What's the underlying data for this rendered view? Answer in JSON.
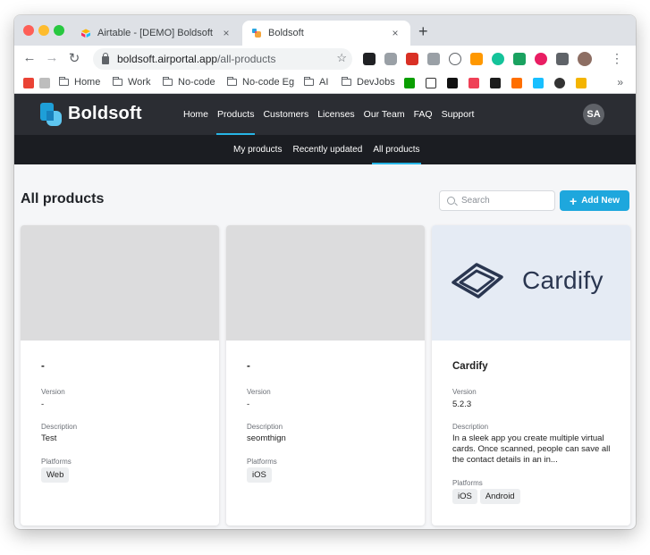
{
  "browser": {
    "tabs": [
      {
        "title": "Airtable - [DEMO] Boldsoft",
        "active": false
      },
      {
        "title": "Boldsoft",
        "active": true
      }
    ],
    "tab_close_glyph": "×",
    "new_tab_glyph": "+",
    "nav": {
      "back_glyph": "←",
      "forward_glyph": "→",
      "reload_glyph": "↻"
    },
    "url": {
      "host": "boldsoft.airportal.app",
      "path": "/all-products"
    },
    "star_glyph": "☆",
    "menu_glyph": "⋮",
    "bookmarks": [
      {
        "label": "Home",
        "icon": "folder-icon"
      },
      {
        "label": "Work",
        "icon": "folder-icon"
      },
      {
        "label": "No-code",
        "icon": "folder-icon"
      },
      {
        "label": "No-code Eg",
        "icon": "folder-icon"
      },
      {
        "label": "AI",
        "icon": "folder-icon"
      },
      {
        "label": "DevJobs",
        "icon": "folder-icon"
      }
    ],
    "bookmark_more_glyph": "»"
  },
  "app": {
    "brand": "Boldsoft",
    "nav": [
      "Home",
      "Products",
      "Customers",
      "Licenses",
      "Our Team",
      "FAQ",
      "Support"
    ],
    "nav_active": "Products",
    "user_initials": "SA",
    "subnav": [
      "My products",
      "Recently updated",
      "All products"
    ],
    "subnav_active": "All products",
    "accent_color": "#27b5e6",
    "header_color": "#2b2d33"
  },
  "page": {
    "title": "All products",
    "search_placeholder": "Search",
    "add_button": "Add New",
    "add_button_glyph": "+"
  },
  "labels": {
    "version": "Version",
    "description": "Description",
    "platforms": "Platforms"
  },
  "products": [
    {
      "name": "-",
      "version": "-",
      "description": "Test",
      "platforms": [
        "Web"
      ],
      "cover": "blank"
    },
    {
      "name": "-",
      "version": "-",
      "description": "seomthign",
      "platforms": [
        "iOS"
      ],
      "cover": "blank"
    },
    {
      "name": "Cardify",
      "version": "5.2.3",
      "description": "In a sleek app you create multiple virtual cards. Once scanned, people can save all the contact details in an in...",
      "platforms": [
        "iOS",
        "Android"
      ],
      "cover": "cardify",
      "cover_text": "Cardify"
    }
  ]
}
